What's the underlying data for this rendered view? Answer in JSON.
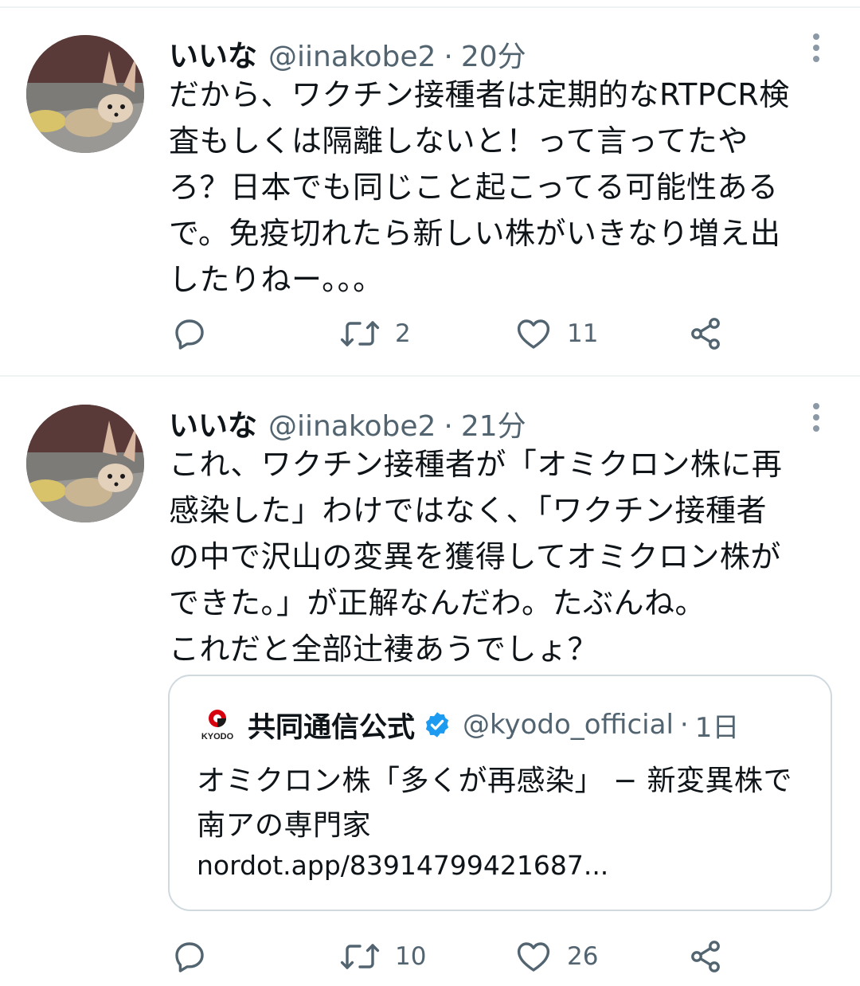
{
  "tweets": [
    {
      "name": "いいな",
      "handle": "@iinakobe2",
      "separator": "·",
      "time": "20分",
      "text": "だから、ワクチン接種者は定期的なRTPCR検\n査もしくは隔離しないと！って言ってたや\nろ？日本でも同じこと起こってる可能性ある\nで。免疫切れたら新しい株がいきなり増え出\nしたりねー。。。",
      "retweets": "2",
      "likes": "11",
      "reply_icon": "reply-icon",
      "retweet_icon": "retweet-icon",
      "like_icon": "heart-icon",
      "share_icon": "share-icon"
    },
    {
      "name": "いいな",
      "handle": "@iinakobe2",
      "separator": "·",
      "time": "21分",
      "text": "これ、ワクチン接種者が「オミクロン株に再\n感染した」わけではなく、「ワクチン接種者\nの中で沢山の変異を獲得してオミクロン株が\nできた。」が正解なんだわ。たぶんね。\nこれだと全部辻褄あうでしょ？",
      "retweets": "10",
      "likes": "26",
      "reply_icon": "reply-icon",
      "retweet_icon": "retweet-icon",
      "like_icon": "heart-icon",
      "share_icon": "share-icon",
      "quote": {
        "logo_text": "KYODO",
        "name": "共同通信公式",
        "handle": "@kyodo_official",
        "separator": "·",
        "time": "1日",
        "text": "オミクロン株「多くが再感染」 − 新変異株で南アの専門家",
        "link": "nordot.app/83914799421687..."
      }
    }
  ],
  "colors": {
    "text": "#0f1419",
    "secondary": "#536471",
    "border": "#cfd9de",
    "divider": "#eff3f4",
    "verified": "#1d9bf0",
    "kyodo_red": "#d7000f"
  }
}
